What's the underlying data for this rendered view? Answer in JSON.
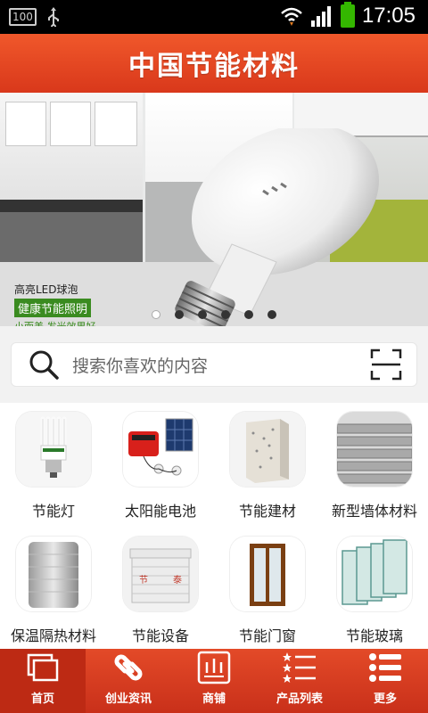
{
  "status_bar": {
    "badge": "100",
    "time": "17:05"
  },
  "header": {
    "title": "中国节能材料"
  },
  "banner": {
    "promo_line1": "高亮LED球泡",
    "promo_line2": "健康节能照明",
    "promo_line3": "小而美 发光效果好",
    "slide_count": 6,
    "active_slide": 0
  },
  "search": {
    "placeholder": "搜索你喜欢的内容"
  },
  "categories": [
    {
      "label": "节能灯",
      "icon": "cfl-bulb-icon"
    },
    {
      "label": "太阳能电池",
      "icon": "solar-kit-icon"
    },
    {
      "label": "节能建材",
      "icon": "insulation-board-icon"
    },
    {
      "label": "新型墙体材料",
      "icon": "wall-panel-icon"
    },
    {
      "label": "保温隔热材料",
      "icon": "foil-roll-icon"
    },
    {
      "label": "节能设备",
      "icon": "cooling-tower-icon"
    },
    {
      "label": "节能门窗",
      "icon": "window-frame-icon"
    },
    {
      "label": "节能玻璃",
      "icon": "glass-panes-icon"
    }
  ],
  "tabs": [
    {
      "label": "首页",
      "icon": "home-icon",
      "active": true
    },
    {
      "label": "创业资讯",
      "icon": "link-icon",
      "active": false
    },
    {
      "label": "商铺",
      "icon": "shop-icon",
      "active": false
    },
    {
      "label": "产品列表",
      "icon": "star-list-icon",
      "active": false
    },
    {
      "label": "更多",
      "icon": "more-list-icon",
      "active": false
    }
  ],
  "colors": {
    "brand": "#e0431f",
    "promo_green": "#3a8b20",
    "battery": "#34b700"
  }
}
